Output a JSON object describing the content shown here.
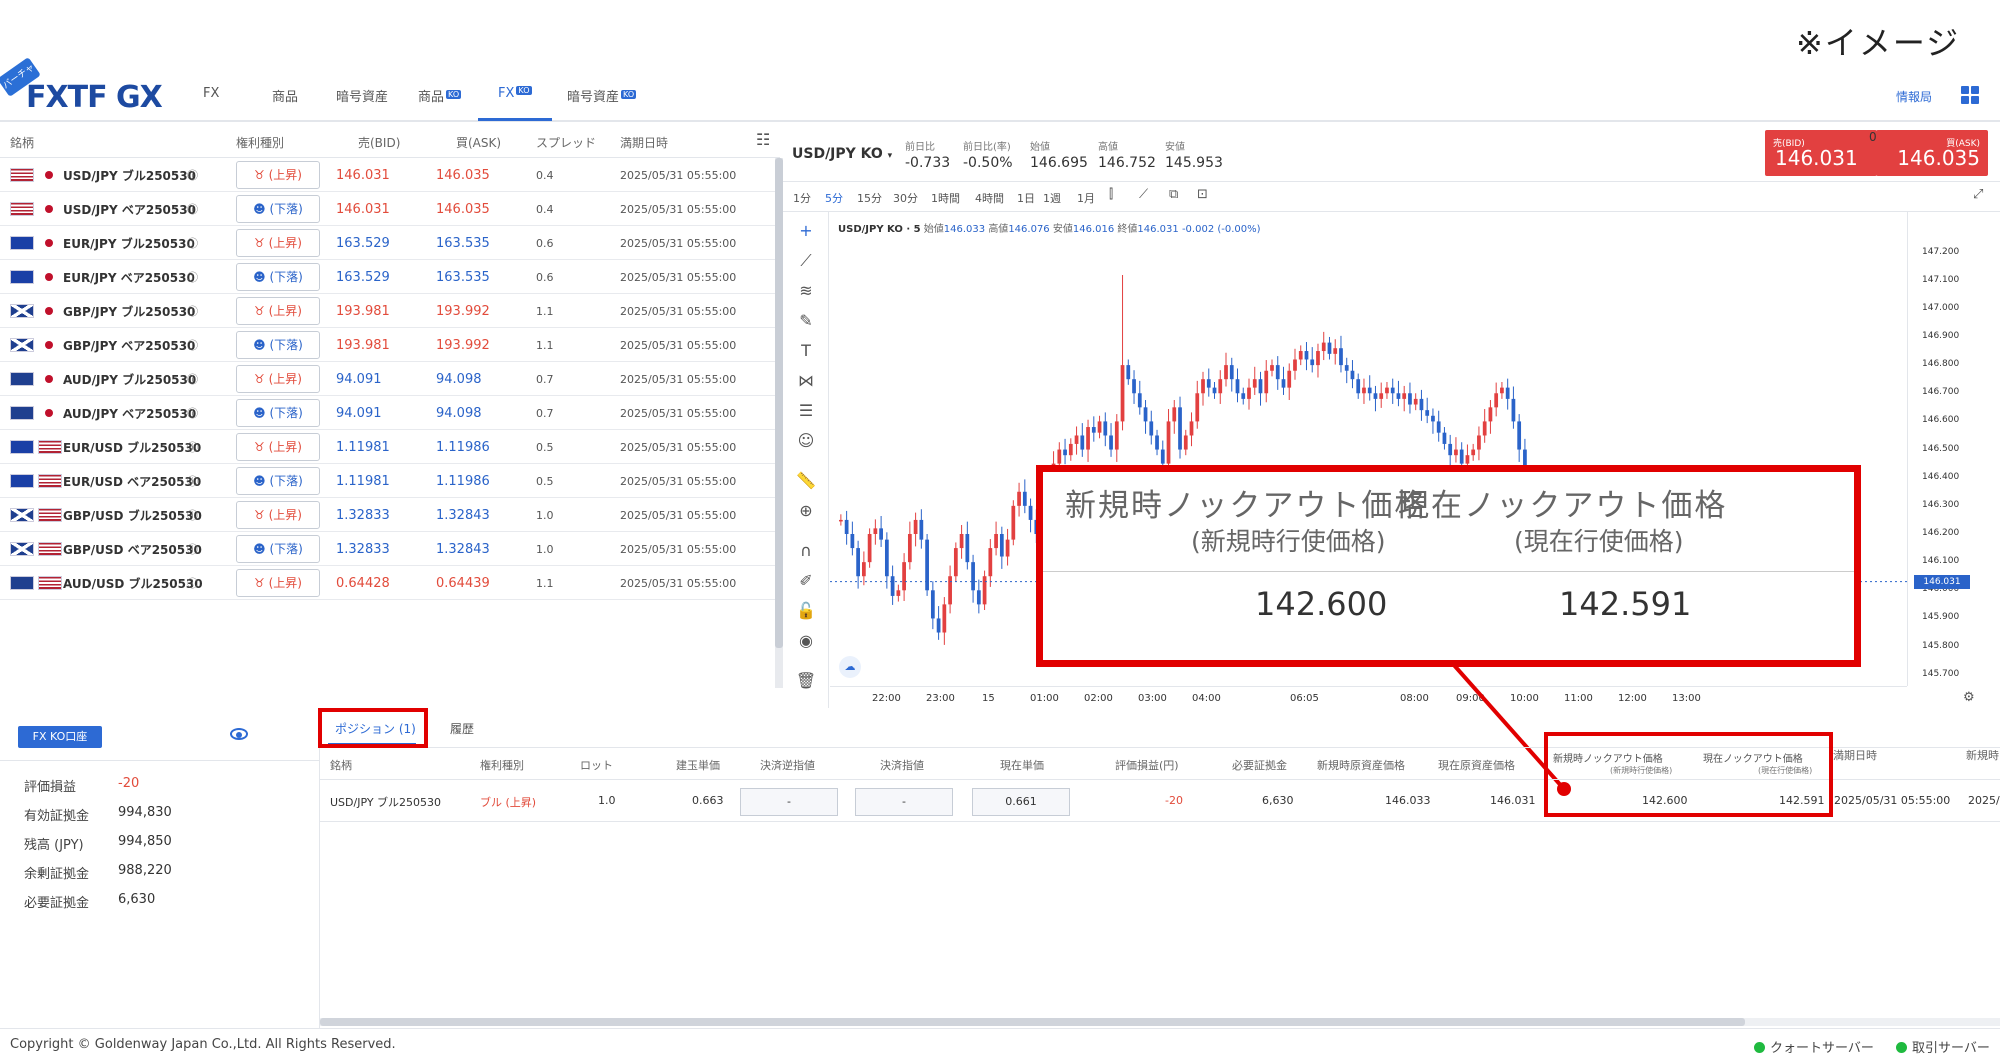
{
  "caption": "※イメージ",
  "app": {
    "logo_text": "FXTF GX",
    "logo_badge": "バーチャル",
    "nav": [
      {
        "label": "FX",
        "ko": ""
      },
      {
        "label": "商品",
        "ko": ""
      },
      {
        "label": "暗号資産",
        "ko": ""
      },
      {
        "label": "商品",
        "ko": "KO"
      },
      {
        "label": "FX",
        "ko": "KO"
      },
      {
        "label": "暗号資産",
        "ko": "KO"
      }
    ],
    "info_link": "情報局"
  },
  "market_table": {
    "headers": [
      "銘柄",
      "権利種別",
      "売(BID)",
      "買(ASK)",
      "スプレッド",
      "満期日時"
    ],
    "rows": [
      {
        "flags": [
          "us"
        ],
        "symbol": "USD/JPY ブル250530",
        "type": "(上昇)",
        "dir": "up",
        "bid": "146.031",
        "ask": "146.035",
        "bid_color": "red",
        "spread": "0.4",
        "expiry": "2025/05/31 05:55:00"
      },
      {
        "flags": [
          "us"
        ],
        "symbol": "USD/JPY ベア250530",
        "type": "(下落)",
        "dir": "dn",
        "bid": "146.031",
        "ask": "146.035",
        "bid_color": "red",
        "spread": "0.4",
        "expiry": "2025/05/31 05:55:00"
      },
      {
        "flags": [
          "eu"
        ],
        "symbol": "EUR/JPY ブル250530",
        "type": "(上昇)",
        "dir": "up",
        "bid": "163.529",
        "ask": "163.535",
        "bid_color": "blue",
        "spread": "0.6",
        "expiry": "2025/05/31 05:55:00"
      },
      {
        "flags": [
          "eu"
        ],
        "symbol": "EUR/JPY ベア250530",
        "type": "(下落)",
        "dir": "dn",
        "bid": "163.529",
        "ask": "163.535",
        "bid_color": "blue",
        "spread": "0.6",
        "expiry": "2025/05/31 05:55:00"
      },
      {
        "flags": [
          "gb"
        ],
        "symbol": "GBP/JPY ブル250530",
        "type": "(上昇)",
        "dir": "up",
        "bid": "193.981",
        "ask": "193.992",
        "bid_color": "red",
        "spread": "1.1",
        "expiry": "2025/05/31 05:55:00"
      },
      {
        "flags": [
          "gb"
        ],
        "symbol": "GBP/JPY ベア250530",
        "type": "(下落)",
        "dir": "dn",
        "bid": "193.981",
        "ask": "193.992",
        "bid_color": "red",
        "spread": "1.1",
        "expiry": "2025/05/31 05:55:00"
      },
      {
        "flags": [
          "au"
        ],
        "symbol": "AUD/JPY ブル250530",
        "type": "(上昇)",
        "dir": "up",
        "bid": "94.091",
        "ask": "94.098",
        "bid_color": "blue",
        "spread": "0.7",
        "expiry": "2025/05/31 05:55:00"
      },
      {
        "flags": [
          "au"
        ],
        "symbol": "AUD/JPY ベア250530",
        "type": "(下落)",
        "dir": "dn",
        "bid": "94.091",
        "ask": "94.098",
        "bid_color": "blue",
        "spread": "0.7",
        "expiry": "2025/05/31 05:55:00"
      },
      {
        "flags": [
          "eu",
          "us"
        ],
        "symbol": "EUR/USD ブル250530",
        "type": "(上昇)",
        "dir": "up",
        "bid": "1.11981",
        "ask": "1.11986",
        "bid_color": "blue",
        "spread": "0.5",
        "expiry": "2025/05/31 05:55:00"
      },
      {
        "flags": [
          "eu",
          "us"
        ],
        "symbol": "EUR/USD ベア250530",
        "type": "(下落)",
        "dir": "dn",
        "bid": "1.11981",
        "ask": "1.11986",
        "bid_color": "blue",
        "spread": "0.5",
        "expiry": "2025/05/31 05:55:00"
      },
      {
        "flags": [
          "gb",
          "us"
        ],
        "symbol": "GBP/USD ブル250530",
        "type": "(上昇)",
        "dir": "up",
        "bid": "1.32833",
        "ask": "1.32843",
        "bid_color": "blue",
        "spread": "1.0",
        "expiry": "2025/05/31 05:55:00"
      },
      {
        "flags": [
          "gb",
          "us"
        ],
        "symbol": "GBP/USD ベア250530",
        "type": "(下落)",
        "dir": "dn",
        "bid": "1.32833",
        "ask": "1.32843",
        "bid_color": "blue",
        "spread": "1.0",
        "expiry": "2025/05/31 05:55:00"
      },
      {
        "flags": [
          "au",
          "us"
        ],
        "symbol": "AUD/USD ブル250530",
        "type": "(上昇)",
        "dir": "up",
        "bid": "0.64428",
        "ask": "0.64439",
        "bid_color": "red",
        "spread": "1.1",
        "expiry": "2025/05/31 05:55:00"
      }
    ]
  },
  "chart_header": {
    "symbol": "USD/JPY KO",
    "stats": [
      {
        "label": "前日比",
        "value": "-0.733",
        "color": "blue"
      },
      {
        "label": "前日比(率)",
        "value": "-0.50%",
        "color": "blue"
      },
      {
        "label": "始値",
        "value": "146.695",
        "color": "dark"
      },
      {
        "label": "高値",
        "value": "146.752",
        "color": "dark"
      },
      {
        "label": "安値",
        "value": "145.953",
        "color": "dark"
      }
    ],
    "bid_label": "売(BID)",
    "bid": "146.031",
    "spread": "0.4",
    "ask_label": "買(ASK)",
    "ask": "146.035",
    "timeframes": [
      "1分",
      "5分",
      "15分",
      "30分",
      "1時間",
      "4時間",
      "1日",
      "1週",
      "1月"
    ],
    "active_timeframe": "5分"
  },
  "chart_legend": {
    "symbol": "USD/JPY KO · 5",
    "open_label": "始値",
    "open": "146.033",
    "high_label": "高値",
    "high": "146.076",
    "low_label": "安値",
    "low": "146.016",
    "close_label": "終値",
    "close": "146.031",
    "change": "-0.002 (-0.00%)"
  },
  "chart_data": {
    "type": "candlestick",
    "title": "USD/JPY KO · 5",
    "y_ticks": [
      "147.200",
      "147.100",
      "147.000",
      "146.900",
      "146.800",
      "146.700",
      "146.600",
      "146.500",
      "146.400",
      "146.300",
      "146.200",
      "146.100",
      "146.000",
      "145.900",
      "145.800",
      "145.700"
    ],
    "ylim": [
      145.66,
      147.28
    ],
    "x_ticks": [
      "22:00",
      "23:00",
      "15",
      "01:00",
      "02:00",
      "03:00",
      "04:00",
      "06:05",
      "08:00",
      "09:00",
      "10:00",
      "11:00",
      "12:00",
      "13:00"
    ],
    "last_price": "146.031",
    "last_value": 146.031,
    "up_color": "#e24040",
    "down_color": "#2a63c9"
  },
  "callout": {
    "head_new": "新規時ノックアウト価格",
    "sub_new": "(新規時行使価格)",
    "head_cur": "現在ノックアウト価格",
    "sub_cur": "(現在行使価格)",
    "val_new": "142.600",
    "val_cur": "142.591"
  },
  "account": {
    "button": "FX KO口座",
    "items": [
      {
        "label": "評価損益",
        "value": "-20",
        "color": "red"
      },
      {
        "label": "有効証拠金",
        "value": "994,830",
        "color": "dark"
      },
      {
        "label": "残高 (JPY)",
        "value": "994,850",
        "color": "dark"
      },
      {
        "label": "余剰証拠金",
        "value": "988,220",
        "color": "dark"
      },
      {
        "label": "必要証拠金",
        "value": "6,630",
        "color": "dark"
      }
    ]
  },
  "positions": {
    "tabs": [
      "ポジション (1)",
      "履歴"
    ],
    "headers": [
      "銘柄",
      "権利種別",
      "ロット",
      "建玉単価",
      "決済逆指値",
      "決済指値",
      "現在単価",
      "評価損益(円)",
      "必要証拠金",
      "新規時原資産価格",
      "現在原資産価格",
      "新規時ノックアウト価格",
      "(新規時行使価格)",
      "現在ノックアウト価格",
      "(現在行使価格)",
      "満期日時",
      "新規時"
    ],
    "row": {
      "symbol": "USD/JPY ブル250530",
      "type": "ブル (上昇)",
      "lot": "1.0",
      "entry": "0.663",
      "stop": "-",
      "limit": "-",
      "current": "0.661",
      "pnl": "-20",
      "margin": "6,630",
      "new_underlying": "146.033",
      "cur_underlying": "146.031",
      "new_ko": "142.600",
      "cur_ko": "142.591",
      "expiry": "2025/05/31 05:55:00",
      "expiry_cut": "2025/"
    }
  },
  "footer": {
    "copyright": "Copyright © Goldenway Japan Co.,Ltd. All Rights Reserved.",
    "quote_server": "クォートサーバー",
    "trade_server": "取引サーバー"
  }
}
